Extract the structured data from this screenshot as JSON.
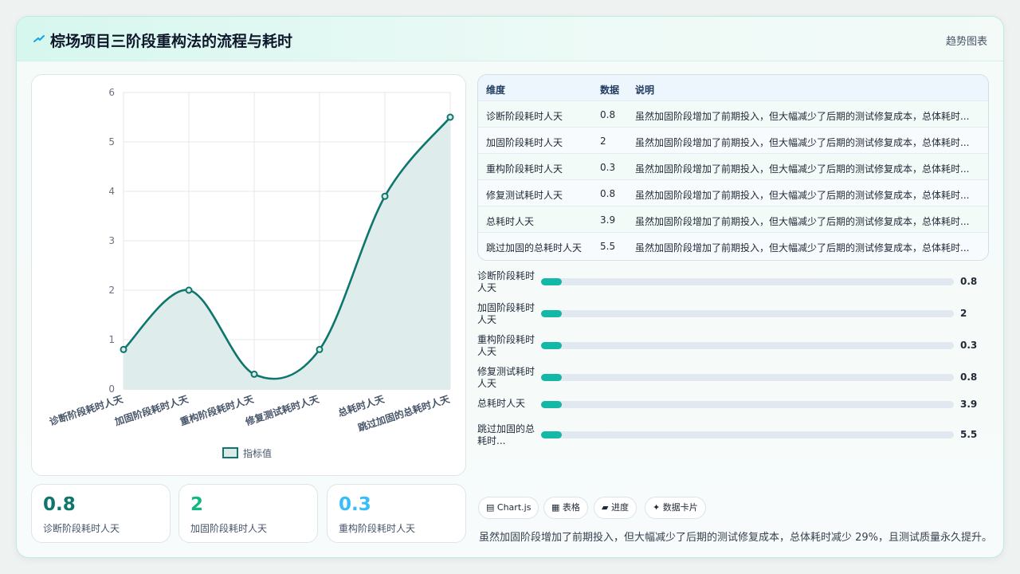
{
  "header": {
    "logo_icon": "sparkle-icon",
    "title": "棕场项目三阶段重构法的流程与耗时",
    "subtitle": "趋势图表"
  },
  "chart_data": {
    "type": "line",
    "categories": [
      "诊断阶段耗时人天",
      "加固阶段耗时人天",
      "重构阶段耗时人天",
      "修复测试耗时人天",
      "总耗时人天",
      "跳过加固的总耗时人天"
    ],
    "series": [
      {
        "name": "指标值",
        "values": [
          0.8,
          2,
          0.3,
          0.8,
          3.9,
          5.5
        ]
      }
    ],
    "yticks": [
      "0",
      "1",
      "2",
      "3",
      "4",
      "5",
      "6"
    ],
    "ylim": [
      0,
      6
    ],
    "grid": true,
    "fill": "area",
    "legend": "bottom",
    "line_color": "#0f766e",
    "fill_color": "#dcebea"
  },
  "kpis": [
    {
      "value": "0.8",
      "label": "诊断阶段耗时人天",
      "color": "#0f766e"
    },
    {
      "value": "2",
      "label": "加固阶段耗时人天",
      "color": "#10b981"
    },
    {
      "value": "0.3",
      "label": "重构阶段耗时人天",
      "color": "#38bdf8"
    }
  ],
  "table": {
    "headers": [
      "维度",
      "数据",
      "说明"
    ],
    "rows": [
      [
        "诊断阶段耗时人天",
        "0.8",
        "虽然加固阶段增加了前期投入，但大幅减少了后期的测试修复成本，总体耗时..."
      ],
      [
        "加固阶段耗时人天",
        "2",
        "虽然加固阶段增加了前期投入，但大幅减少了后期的测试修复成本，总体耗时..."
      ],
      [
        "重构阶段耗时人天",
        "0.3",
        "虽然加固阶段增加了前期投入，但大幅减少了后期的测试修复成本，总体耗时..."
      ],
      [
        "修复测试耗时人天",
        "0.8",
        "虽然加固阶段增加了前期投入，但大幅减少了后期的测试修复成本，总体耗时..."
      ],
      [
        "总耗时人天",
        "3.9",
        "虽然加固阶段增加了前期投入，但大幅减少了后期的测试修复成本，总体耗时..."
      ],
      [
        "跳过加固的总耗时人天",
        "5.5",
        "虽然加固阶段增加了前期投入，但大幅减少了后期的测试修复成本，总体耗时..."
      ]
    ]
  },
  "progress": [
    {
      "label_l1": "诊断阶段耗时",
      "label_l2": "人天",
      "value": "0.8",
      "fill_fraction": 0.05
    },
    {
      "label_l1": "加固阶段耗时",
      "label_l2": "人天",
      "value": "2",
      "fill_fraction": 0.05
    },
    {
      "label_l1": "重构阶段耗时",
      "label_l2": "人天",
      "value": "0.3",
      "fill_fraction": 0.05
    },
    {
      "label_l1": "修复测试耗时",
      "label_l2": "人天",
      "value": "0.8",
      "fill_fraction": 0.05
    },
    {
      "label_l1": "总耗时人天",
      "label_l2": "",
      "value": "3.9",
      "fill_fraction": 0.05
    },
    {
      "label_l1": "跳过加固的总",
      "label_l2": "耗时...",
      "value": "5.5",
      "fill_fraction": 0.05
    }
  ],
  "chips": [
    {
      "icon": "chart-icon",
      "glyph": "▤",
      "label": "Chart.js"
    },
    {
      "icon": "table-icon",
      "glyph": "▦",
      "label": "表格"
    },
    {
      "icon": "progress-icon",
      "glyph": "▰",
      "label": "进度"
    },
    {
      "icon": "card-icon",
      "glyph": "✦",
      "label": "数据卡片"
    }
  ],
  "footer_note": "虽然加固阶段增加了前期投入，但大幅减少了后期的测试修复成本，总体耗时减少 29%，且测试质量永久提升。"
}
